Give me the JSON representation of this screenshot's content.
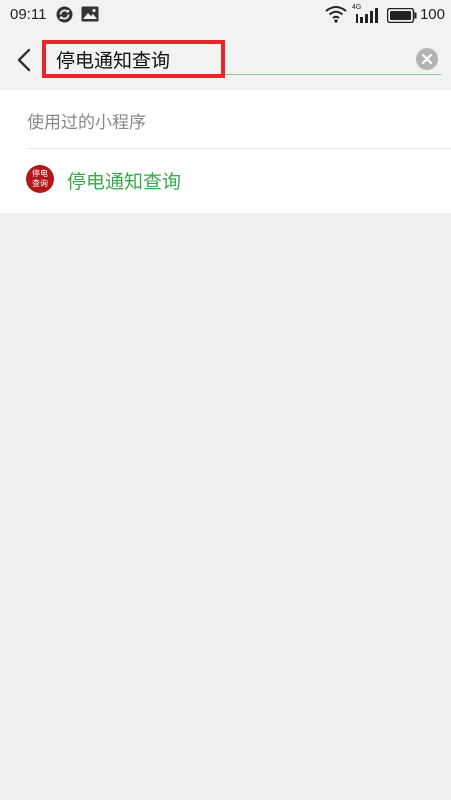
{
  "status_bar": {
    "time": "09:11",
    "network_label": "4G",
    "battery_level": "100"
  },
  "search": {
    "value": "停电通知查询",
    "accent_color": "#8cc78c",
    "highlight_color": "#e8262c"
  },
  "results": {
    "section_header": "使用过的小程序",
    "items": [
      {
        "name": "停电通知查询",
        "logo_text_line1": "停电",
        "logo_text_line2": "查询",
        "name_color": "#3aa94c",
        "logo_color": "#b3171c"
      }
    ]
  },
  "icons": {
    "sync": "sync-icon",
    "image": "image-icon",
    "wifi": "wifi-icon",
    "signal": "signal-icon",
    "battery": "battery-icon",
    "back": "back-arrow-icon",
    "clear": "clear-icon"
  }
}
